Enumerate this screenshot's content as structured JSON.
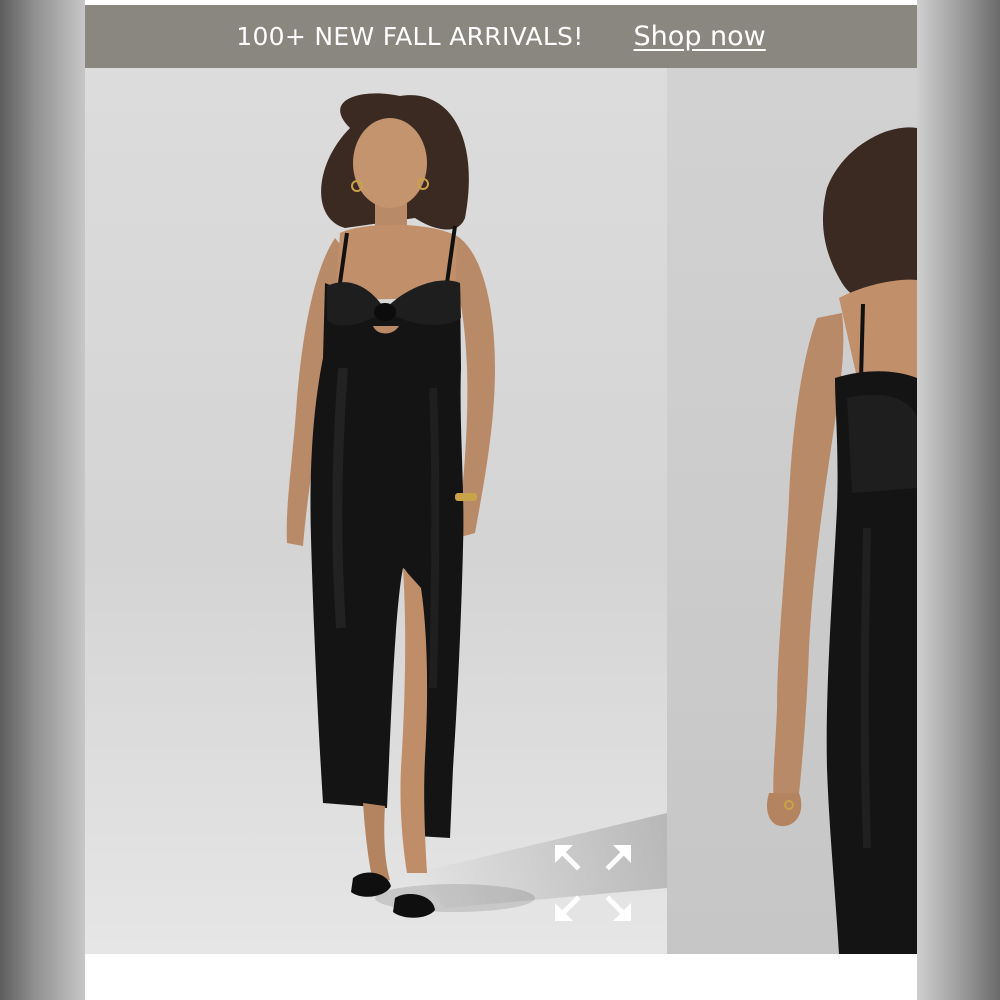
{
  "promo": {
    "text": "100+ NEW FALL ARRIVALS!",
    "link_label": "Shop now"
  },
  "gallery": {
    "slides": [
      {
        "subject": "model in black satin slip maxi dress with bow bust and front slit"
      },
      {
        "subject": "partial side view of same dress"
      }
    ],
    "expand_icon": "expand-arrows-icon"
  },
  "colors": {
    "promo_bg": "#8a8680",
    "dress": "#141414",
    "backdrop": "#d8d8d8"
  }
}
